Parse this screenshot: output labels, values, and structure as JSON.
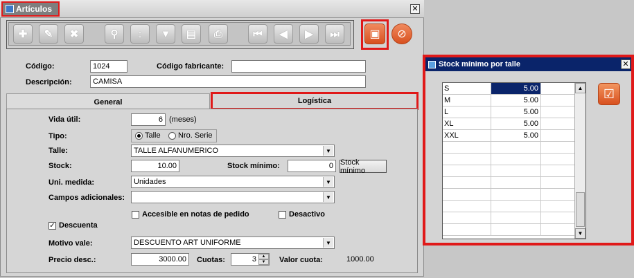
{
  "window": {
    "title": "Artículos",
    "close_glyph": "✕"
  },
  "toolbar": {
    "buttons": [
      {
        "icon": "add-icon",
        "glyph": "✚"
      },
      {
        "icon": "edit-icon",
        "glyph": "✎"
      },
      {
        "icon": "delete-icon",
        "glyph": "✖"
      },
      {
        "icon": "search-icon",
        "glyph": "⚲"
      },
      {
        "icon": "sort-icon",
        "glyph": "↕"
      },
      {
        "icon": "filter-icon",
        "glyph": "▼"
      },
      {
        "icon": "clipboard-icon",
        "glyph": "▤"
      },
      {
        "icon": "print-icon",
        "glyph": "⎙"
      },
      {
        "icon": "first-record-icon",
        "glyph": "⏮"
      },
      {
        "icon": "previous-record-icon",
        "glyph": "◀"
      },
      {
        "icon": "next-record-icon",
        "glyph": "▶"
      },
      {
        "icon": "last-record-icon",
        "glyph": "⏭"
      }
    ],
    "save_glyph": "▣",
    "cancel_glyph": "⊘"
  },
  "form": {
    "codigo_label": "Código:",
    "codigo_value": "1024",
    "codigo_fabricante_label": "Código fabricante:",
    "codigo_fabricante_value": "",
    "descripcion_label": "Descripción:",
    "descripcion_value": "CAMISA"
  },
  "tabs": {
    "general": "General",
    "logistica": "Logística"
  },
  "logistica": {
    "vida_util_label": "Vida útil:",
    "vida_util_value": "6",
    "vida_util_unit": "(meses)",
    "tipo_label": "Tipo:",
    "tipo_option1": "Talle",
    "tipo_option2": "Nro. Serie",
    "talle_label": "Talle:",
    "talle_value": "TALLE ALFANUMERICO",
    "stock_label": "Stock:",
    "stock_value": "10.00",
    "stock_minimo_label": "Stock mínimo:",
    "stock_minimo_value": "0",
    "stock_minimo_button": "Stock mínimo",
    "uni_medida_label": "Uni. medida:",
    "uni_medida_value": "Unidades",
    "campos_label": "Campos adicionales:",
    "campos_value": "",
    "accesible_label": "Accesible en notas de pedido",
    "desactivo_label": "Desactivo",
    "descuenta_label": "Descuenta",
    "check_glyph": "✓",
    "motivo_label": "Motivo vale:",
    "motivo_value": "DESCUENTO ART UNIFORME",
    "precio_label": "Precio desc.:",
    "precio_value": "3000.00",
    "cuotas_label": "Cuotas:",
    "cuotas_value": "3",
    "valor_cuota_label": "Valor cuota:",
    "valor_cuota_value": "1000.00"
  },
  "dialog": {
    "title": "Stock mínimo por talle",
    "close_glyph": "✕",
    "rows": [
      {
        "talle": "S",
        "valor": "5.00"
      },
      {
        "talle": "M",
        "valor": "5.00"
      },
      {
        "talle": "L",
        "valor": "5.00"
      },
      {
        "talle": "XL",
        "valor": "5.00"
      },
      {
        "talle": "XXL",
        "valor": "5.00"
      }
    ],
    "confirm_glyph": "☑"
  }
}
